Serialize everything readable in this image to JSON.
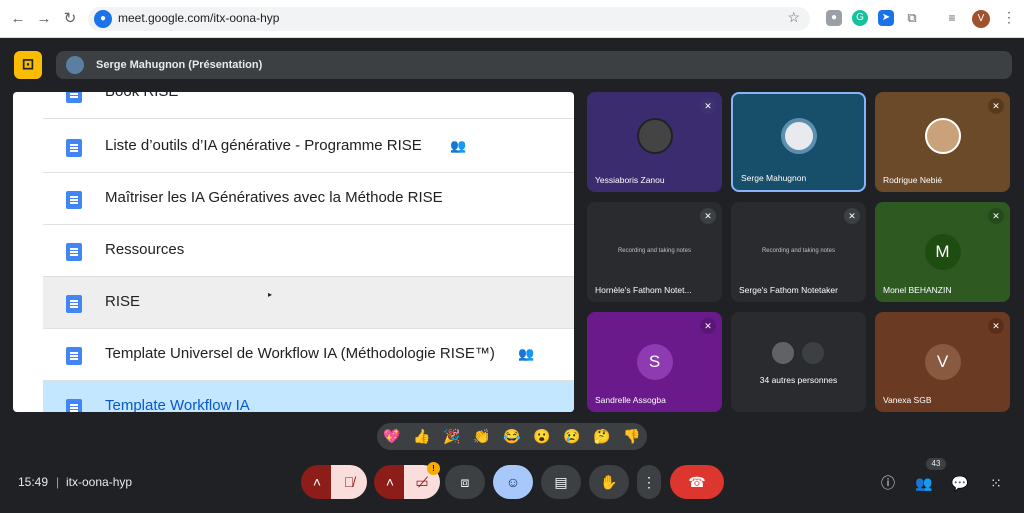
{
  "browser": {
    "url": "meet.google.com/itx-oona-hyp",
    "back_icon": "←",
    "forward_icon": "→",
    "reload_icon": "↻",
    "profile_initial": "V"
  },
  "meet": {
    "presenter_label": "Serge Mahugnon (Présentation)"
  },
  "presentation": {
    "files": [
      {
        "name": "Book RISE"
      },
      {
        "name": "Liste d’outils d’IA générative - Programme RISE"
      },
      {
        "name": "Maîtriser les IA Génératives avec la Méthode RISE"
      },
      {
        "name": "Ressources"
      },
      {
        "name": "RISE"
      },
      {
        "name": "Template Universel de Workflow IA (Méthodologie RISE™)"
      },
      {
        "name": "Template Workflow IA"
      }
    ]
  },
  "participants": [
    {
      "name": "Yessiaboris Zanou"
    },
    {
      "name": "Serge Mahugnon"
    },
    {
      "name": "Rodrigue Nebié"
    },
    {
      "name": "Hornèle's Fathom Notet...",
      "status": "Recording and taking notes"
    },
    {
      "name": "Serge's Fathom Notetaker",
      "status": "Recording and taking notes"
    },
    {
      "name": "Monel BEHANZIN",
      "initial": "M"
    },
    {
      "name": "Sandrelle Assogba",
      "initial": "S"
    },
    {
      "name": "34 autres personnes"
    },
    {
      "name": "Vanexa SGB",
      "initial": "V"
    }
  ],
  "reactions": [
    "💖",
    "👍",
    "🎉",
    "👏",
    "😂",
    "😮",
    "😢",
    "🤔",
    "👎"
  ],
  "bottom": {
    "time": "15:49",
    "separator": "|",
    "meeting_code": "itx-oona-hyp",
    "people_count": "43",
    "camera_warning": "!"
  }
}
